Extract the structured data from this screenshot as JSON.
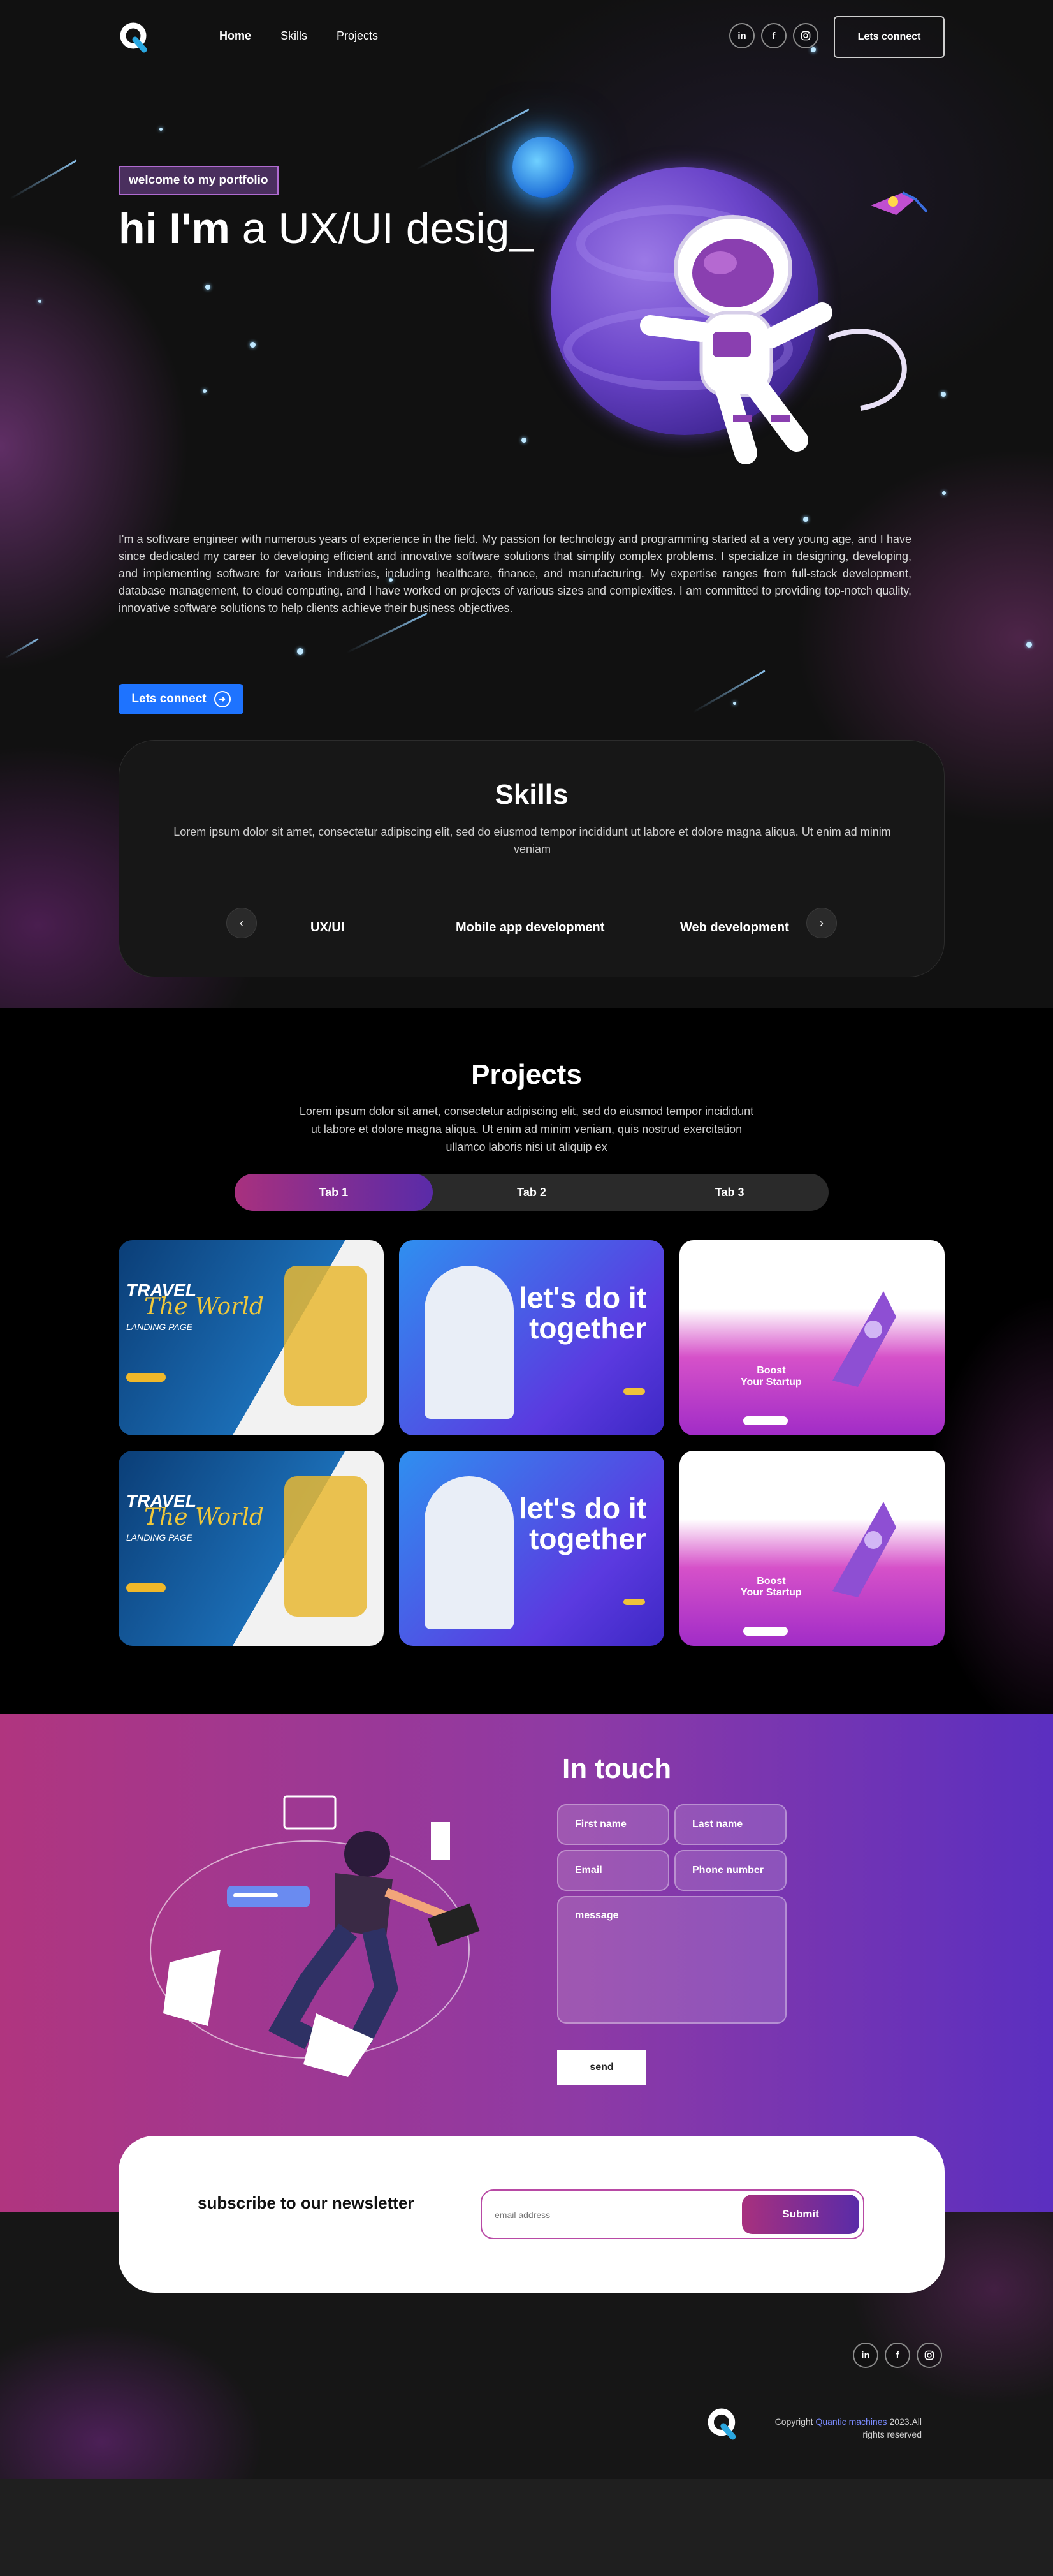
{
  "nav": {
    "links": [
      "Home",
      "Skills",
      "Projects"
    ],
    "connect_label": "Lets connect"
  },
  "social": {
    "linkedin": "in",
    "facebook": "f",
    "instagram_icon": "instagram-icon"
  },
  "hero": {
    "badge": "welcome to my portfolio",
    "title_bold": "hi I'm",
    "title_light": " a UX/UI desig_",
    "description": "I'm a software engineer with numerous years of experience in the field. My passion for technology and programming started at a very young age, and I have since dedicated my career to developing efficient and innovative software solutions that simplify complex problems. I specialize in designing, developing, and implementing software for various industries, including healthcare, finance, and manufacturing. My expertise ranges from full-stack development, database management, to cloud computing, and I have worked on projects of various sizes and complexities. I am committed to providing top-notch quality, innovative software solutions to help clients achieve their business objectives.",
    "cta_label": "Lets connect"
  },
  "skills": {
    "title": "Skills",
    "description": "Lorem ipsum dolor sit amet, consectetur adipiscing elit, sed do eiusmod tempor incididunt ut labore et dolore magna aliqua. Ut enim ad minim veniam",
    "items": [
      "UX/UI",
      "Mobile app development",
      "Web development"
    ]
  },
  "projects": {
    "title": "Projects",
    "description": "Lorem ipsum dolor sit amet, consectetur adipiscing elit, sed do eiusmod tempor incididunt ut labore et dolore magna aliqua. Ut enim ad minim veniam, quis nostrud exercitation ullamco laboris nisi ut aliquip ex",
    "tabs": [
      "Tab 1",
      "Tab 2",
      "Tab 3"
    ],
    "active_tab": 0,
    "cards": [
      {
        "theme": "travel",
        "line1": "TRAVEL",
        "line2": "The World",
        "line3": "LANDING PAGE"
      },
      {
        "theme": "together",
        "line1": "let's do it",
        "line2": "together"
      },
      {
        "theme": "startup",
        "line1": "Boost",
        "line2": "Your Startup"
      }
    ]
  },
  "contact": {
    "title": "In touch",
    "first_name": "First name",
    "last_name": "Last name",
    "email": "Email",
    "phone": "Phone number",
    "message": "message",
    "send_label": "send"
  },
  "newsletter": {
    "title": "subscribe to our newsletter",
    "placeholder": "email address",
    "submit_label": "Submit"
  },
  "footer": {
    "copyright_prefix": "Copyright ",
    "brand": "Quantic machines",
    "copyright_suffix": " 2023.All rights reserved"
  },
  "colors": {
    "accent_blue": "#1e73ff",
    "gradient_pink": "#a8307e",
    "gradient_purple": "#5a2ba8"
  }
}
